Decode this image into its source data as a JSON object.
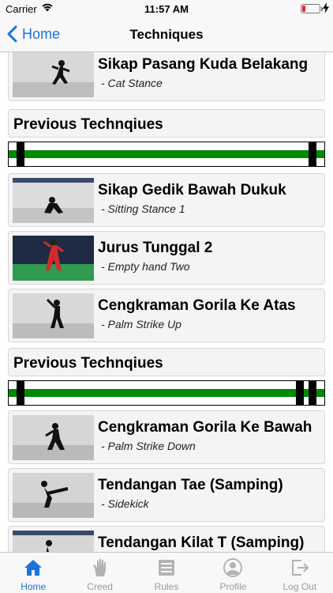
{
  "status": {
    "carrier": "Carrier",
    "time": "11:57 AM"
  },
  "nav": {
    "back_label": "Home",
    "title": "Techniques"
  },
  "colors": {
    "accent": "#1a73d9",
    "belt_stripe": "#008a00",
    "battery_low": "#e0282e"
  },
  "techniques": [
    {
      "title": "Sikap Pasang Kuda Belakang",
      "subtitle": "- Cat Stance"
    },
    {
      "title": "Sikap Gedik Bawah Dukuk",
      "subtitle": "- Sitting Stance 1"
    },
    {
      "title": "Jurus Tunggal 2",
      "subtitle": "- Empty hand Two"
    },
    {
      "title": "Cengkraman Gorila Ke Atas",
      "subtitle": "- Palm Strike Up"
    },
    {
      "title": "Cengkraman Gorila Ke Bawah",
      "subtitle": "- Palm Strike Down"
    },
    {
      "title": "Tendangan Tae (Samping)",
      "subtitle": "- Sidekick"
    },
    {
      "title": "Tendangan Kilat T (Samping)",
      "subtitle": ""
    }
  ],
  "sections": [
    {
      "label": "Previous Technqiues"
    },
    {
      "label": "Previous Technqiues"
    }
  ],
  "tabs": [
    {
      "label": "Home",
      "icon": "home-icon",
      "active": true
    },
    {
      "label": "Creed",
      "icon": "hand-icon",
      "active": false
    },
    {
      "label": "Rules",
      "icon": "list-icon",
      "active": false
    },
    {
      "label": "Profile",
      "icon": "profile-icon",
      "active": false
    },
    {
      "label": "Log Out",
      "icon": "logout-icon",
      "active": false
    }
  ]
}
